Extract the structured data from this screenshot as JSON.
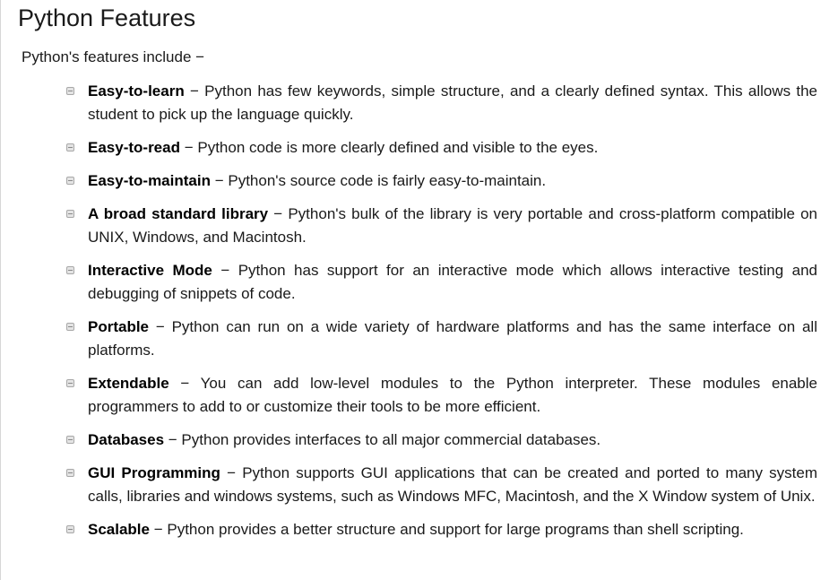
{
  "page": {
    "title": "Python Features",
    "intro": "Python's features include −"
  },
  "features": [
    {
      "term": "Easy-to-learn",
      "description": " − Python has few keywords, simple structure, and a clearly defined syntax. This allows the student to pick up the language quickly."
    },
    {
      "term": "Easy-to-read",
      "description": " − Python code is more clearly defined and visible to the eyes."
    },
    {
      "term": "Easy-to-maintain",
      "description": " − Python's source code is fairly easy-to-maintain."
    },
    {
      "term": "A broad standard library",
      "description": " − Python's bulk of the library is very portable and cross-platform compatible on UNIX, Windows, and Macintosh."
    },
    {
      "term": "Interactive Mode",
      "description": " − Python has support for an interactive mode which allows interactive testing and debugging of snippets of code."
    },
    {
      "term": "Portable",
      "description": " − Python can run on a wide variety of hardware platforms and has the same interface on all platforms."
    },
    {
      "term": "Extendable",
      "description": " − You can add low-level modules to the Python interpreter. These modules enable programmers to add to or customize their tools to be more efficient."
    },
    {
      "term": "Databases",
      "description": " − Python provides interfaces to all major commercial databases."
    },
    {
      "term": "GUI Programming",
      "description": " − Python supports GUI applications that can be created and ported to many system calls, libraries and windows systems, such as Windows MFC, Macintosh, and the X Window system of Unix."
    },
    {
      "term": "Scalable",
      "description": " − Python provides a better structure and support for large programs than shell scripting."
    }
  ]
}
